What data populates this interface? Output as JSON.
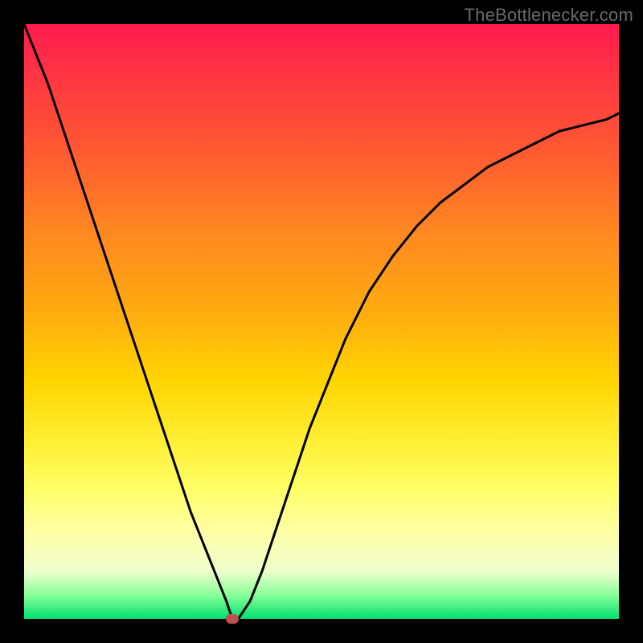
{
  "watermark": "TheBottlenecker.com",
  "chart_data": {
    "type": "line",
    "title": "",
    "xlabel": "",
    "ylabel": "",
    "xlim": [
      0,
      100
    ],
    "ylim": [
      0,
      100
    ],
    "x": [
      0,
      2,
      4,
      6,
      8,
      10,
      12,
      14,
      16,
      18,
      20,
      22,
      24,
      26,
      28,
      30,
      32,
      34,
      35,
      36,
      38,
      40,
      42,
      44,
      46,
      48,
      50,
      52,
      54,
      56,
      58,
      60,
      62,
      66,
      70,
      74,
      78,
      82,
      86,
      90,
      94,
      98,
      100
    ],
    "y": [
      100,
      95,
      90,
      84,
      78,
      72,
      66,
      60,
      54,
      48,
      42,
      36,
      30,
      24,
      18,
      13,
      8,
      3,
      0,
      0,
      3,
      8,
      14,
      20,
      26,
      32,
      37,
      42,
      47,
      51,
      55,
      58,
      61,
      66,
      70,
      73,
      76,
      78,
      80,
      82,
      83,
      84,
      85
    ],
    "marker": {
      "x": 35,
      "y": 0
    },
    "annotations": []
  },
  "colors": {
    "frame": "#000000",
    "curve": "#000000",
    "marker": "#c05050",
    "gradient_top": "#ff1a4d",
    "gradient_bottom": "#00e070"
  }
}
